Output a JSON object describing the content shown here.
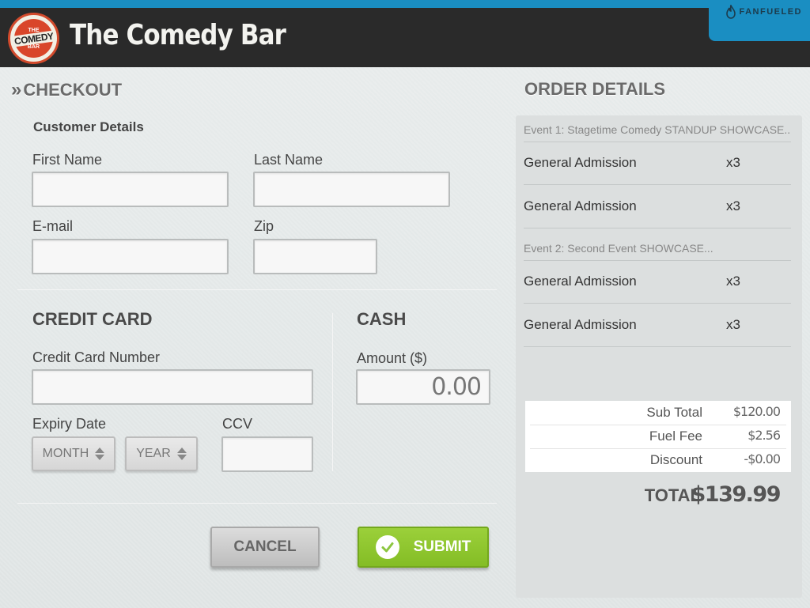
{
  "header": {
    "logo": {
      "top": "THE",
      "middle": "COMEDY",
      "bottom": "BAR"
    },
    "title": "The Comedy Bar",
    "brand": "FANFUELED"
  },
  "checkout": {
    "title": "CHECKOUT",
    "customer_section": "Customer Details",
    "first_name_label": "First Name",
    "first_name_value": "",
    "last_name_label": "Last Name",
    "last_name_value": "",
    "email_label": "E-mail",
    "email_value": "",
    "zip_label": "Zip",
    "zip_value": "",
    "credit_card": {
      "heading": "CREDIT CARD",
      "number_label": "Credit Card Number",
      "number_value": "",
      "expiry_label": "Expiry Date",
      "month_label": "MONTH",
      "year_label": "YEAR",
      "ccv_label": "CCV",
      "ccv_value": ""
    },
    "cash": {
      "heading": "CASH",
      "amount_label": "Amount ($)",
      "amount_placeholder": "0.00"
    },
    "cancel_label": "CANCEL",
    "submit_label": "SUBMIT"
  },
  "order": {
    "title": "ORDER DETAILS",
    "events": [
      {
        "title": "Event 1: Stagetime Comedy STANDUP SHOWCASE...",
        "items": [
          {
            "name": "General Admission",
            "qty": "x3"
          },
          {
            "name": "General Admission",
            "qty": "x3"
          }
        ]
      },
      {
        "title": "Event 2: Second Event SHOWCASE...",
        "items": [
          {
            "name": "General Admission",
            "qty": "x3"
          },
          {
            "name": "General Admission",
            "qty": "x3"
          }
        ]
      }
    ],
    "subtotal_label": "Sub Total",
    "subtotal_value": "$120.00",
    "fee_label": "Fuel Fee",
    "fee_value": "$2.56",
    "discount_label": "Discount",
    "discount_value": "-$0.00",
    "total_label": "TOTAL",
    "total_value": "$139.99"
  },
  "colors": {
    "header_bg": "#2a2a2a",
    "accent_blue": "#1a8ec2",
    "submit_green": "#8cc63f"
  }
}
